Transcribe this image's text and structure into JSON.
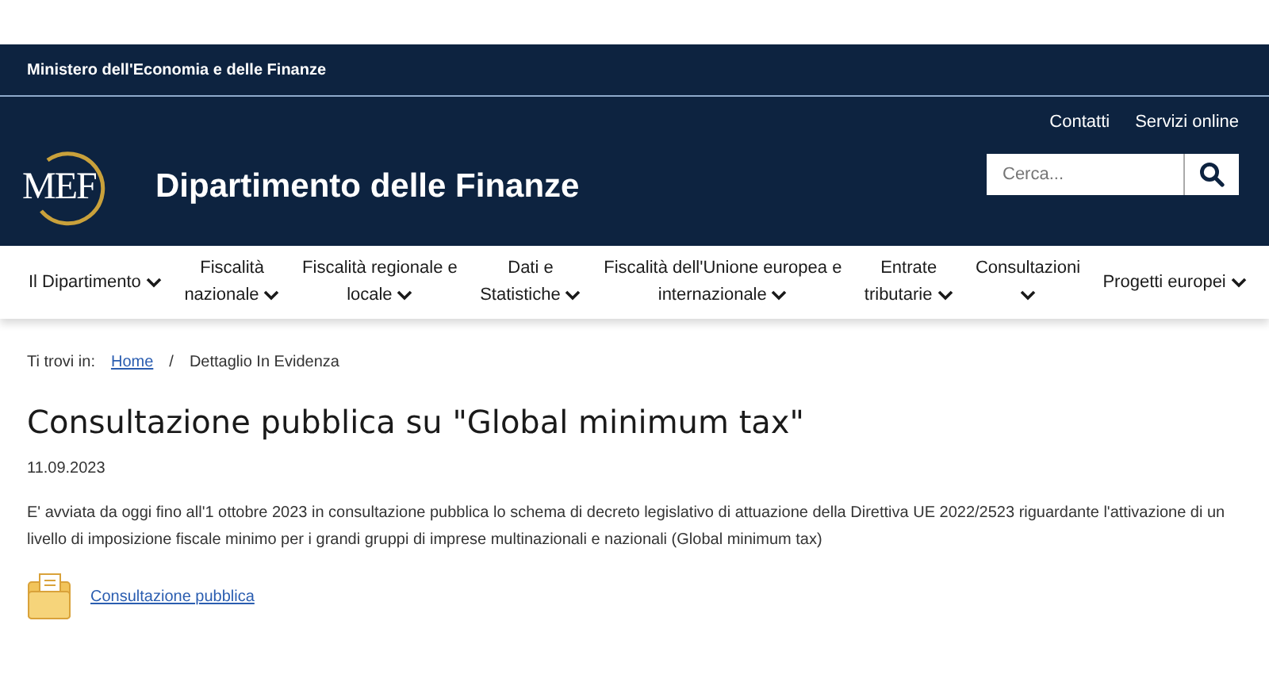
{
  "top_bar": {
    "title": "Ministero dell'Economia e delle Finanze"
  },
  "header": {
    "logo": "MEF",
    "title": "Dipartimento delle Finanze",
    "links": [
      "Contatti",
      "Servizi online"
    ],
    "search": {
      "placeholder": "Cerca..."
    }
  },
  "nav": [
    {
      "label": "Il Dipartimento"
    },
    {
      "label": "Fiscalità\nnazionale"
    },
    {
      "label": "Fiscalità regionale e\nlocale"
    },
    {
      "label": "Dati e\nStatistiche"
    },
    {
      "label": "Fiscalità dell'Unione europea e\ninternazionale"
    },
    {
      "label": "Entrate\ntributarie"
    },
    {
      "label": "Consultazioni\n"
    },
    {
      "label": "Progetti europei"
    }
  ],
  "breadcrumb": {
    "prefix": "Ti trovi in:",
    "separator": "/",
    "items": [
      {
        "label": "Home",
        "kind": "link"
      },
      {
        "label": "Dettaglio In Evidenza",
        "kind": "current"
      }
    ]
  },
  "article": {
    "title": "Consultazione pubblica su \"Global minimum tax\"",
    "date": "11.09.2023",
    "body": "E' avviata da oggi fino all'1 ottobre 2023 in consultazione pubblica lo schema di decreto legislativo di attuazione della Direttiva UE 2022/2523 riguardante l'attivazione di un livello di imposizione fiscale minimo per i grandi gruppi di imprese multinazionali e nazionali (Global minimum tax)",
    "attachment": "Consultazione pubblica"
  }
}
